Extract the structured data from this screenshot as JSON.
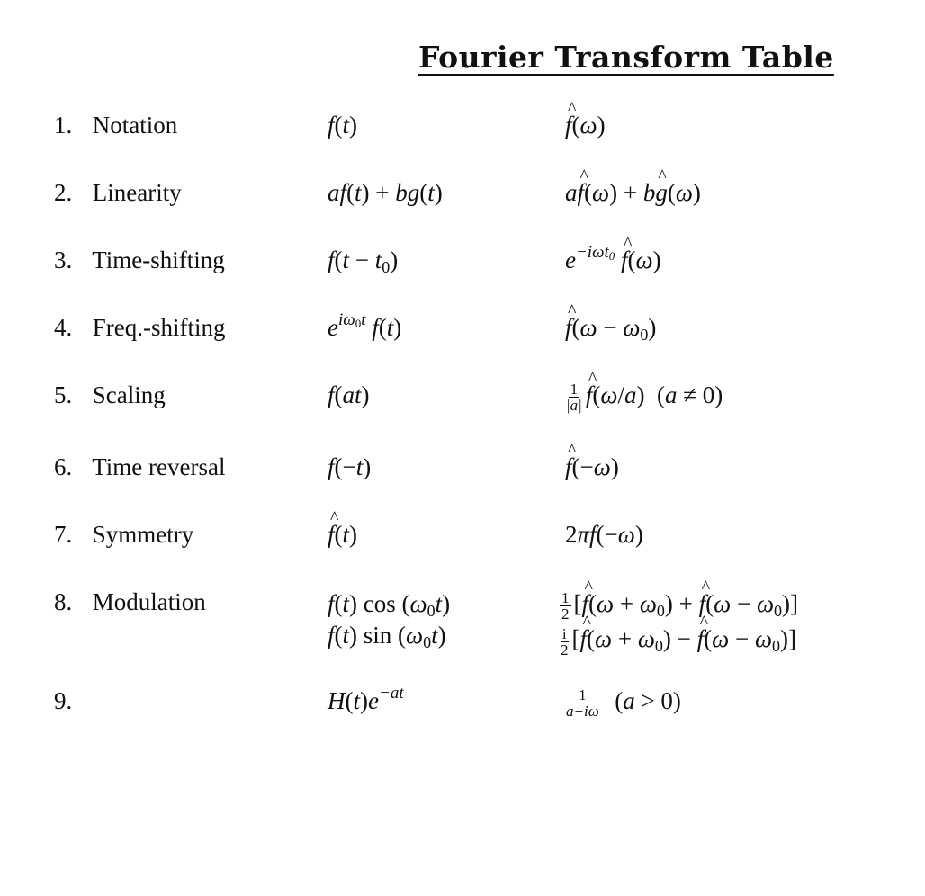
{
  "title": "Fourier Transform Table",
  "rows": [
    {
      "num": "1.",
      "name": "Notation",
      "time": "f(t)",
      "freq": "f̂(ω)"
    },
    {
      "num": "2.",
      "name": "Linearity",
      "time": "af(t) + bg(t)",
      "freq": "af̂(ω) + bĝ(ω)"
    },
    {
      "num": "3.",
      "name": "Time-shifting",
      "time": "f(t − t₀)",
      "freq": "e^{−iωt₀} f̂(ω)"
    },
    {
      "num": "4.",
      "name": "Freq.-shifting",
      "time": "e^{iω₀t} f(t)",
      "freq": "f̂(ω − ω₀)"
    },
    {
      "num": "5.",
      "name": "Scaling",
      "time": "f(at)",
      "freq": "(1/|a|) f̂(ω/a)  (a ≠ 0)"
    },
    {
      "num": "6.",
      "name": "Time reversal",
      "time": "f(−t)",
      "freq": "f̂(−ω)"
    },
    {
      "num": "7.",
      "name": "Symmetry",
      "time": "f̂(t)",
      "freq": "2πf(−ω)"
    },
    {
      "num": "8.",
      "name": "Modulation",
      "time": [
        "f(t) cos(ω₀t)",
        "f(t) sin(ω₀t)"
      ],
      "freq": [
        "(1/2)[f̂(ω + ω₀) + f̂(ω − ω₀)]",
        "(i/2)[f̂(ω + ω₀) − f̂(ω − ω₀)]"
      ]
    },
    {
      "num": "9.",
      "name": "",
      "time": "H(t)e^{−at}",
      "freq": "1/(a + iω)  (a > 0)"
    }
  ],
  "parts": {
    "r1": {
      "t": [
        "f",
        "(",
        "t",
        ")"
      ],
      "w": [
        "f",
        "(",
        "ω",
        ")"
      ]
    },
    "r2": {
      "t": [
        "a",
        "f",
        "(",
        "t",
        ") + ",
        "b",
        "g",
        "(",
        "t",
        ")"
      ],
      "w": [
        "a",
        "f",
        "(",
        "ω",
        ") + ",
        "b",
        "g",
        "(",
        "ω",
        ")"
      ]
    },
    "r3": {
      "t": [
        "f",
        "(",
        "t",
        " − ",
        "t",
        "0",
        ")"
      ],
      "w": [
        "e",
        "−iωt",
        "0",
        "f",
        "(",
        "ω",
        ")"
      ]
    },
    "r4": {
      "t": [
        "e",
        "iω",
        "0",
        "t",
        "f",
        "(",
        "t",
        ")"
      ],
      "w": [
        "f",
        "(",
        "ω",
        " − ",
        "ω",
        "0",
        ")"
      ]
    },
    "r5": {
      "t": [
        "f",
        "(",
        "at",
        ")"
      ],
      "w": [
        "1",
        "|a|",
        "f",
        "(",
        "ω",
        "/",
        "a",
        ")",
        "  (",
        "a",
        " ≠ 0)"
      ]
    },
    "r6": {
      "t": [
        "f",
        "(−",
        "t",
        ")"
      ],
      "w": [
        "f",
        "(−",
        "ω",
        ")"
      ]
    },
    "r7": {
      "t": [
        "f",
        "(",
        "t",
        ")"
      ],
      "w": [
        "2",
        "π",
        "f",
        "(−",
        "ω",
        ")"
      ]
    },
    "r8": {
      "t1": [
        "f",
        "(",
        "t",
        ") cos (",
        "ω",
        "0",
        "t",
        ")"
      ],
      "t2": [
        "f",
        "(",
        "t",
        ") sin (",
        "ω",
        "0",
        "t",
        ")"
      ],
      "w1": [
        "1",
        "2",
        "[",
        "f",
        "(",
        "ω",
        " + ",
        "ω",
        "0",
        ") + ",
        "f",
        "(",
        "ω",
        " − ",
        "ω",
        "0",
        ")]"
      ],
      "w2": [
        "i",
        "2",
        "[",
        "f",
        "(",
        "ω",
        " + ",
        "ω",
        "0",
        ") − ",
        "f",
        "(",
        "ω",
        " − ",
        "ω",
        "0",
        ")]"
      ]
    },
    "r9": {
      "t": [
        "H",
        "(",
        "t",
        ")",
        "e",
        "−at"
      ],
      "w": [
        "1",
        "a+iω",
        "  (",
        "a",
        " > 0)"
      ]
    }
  }
}
